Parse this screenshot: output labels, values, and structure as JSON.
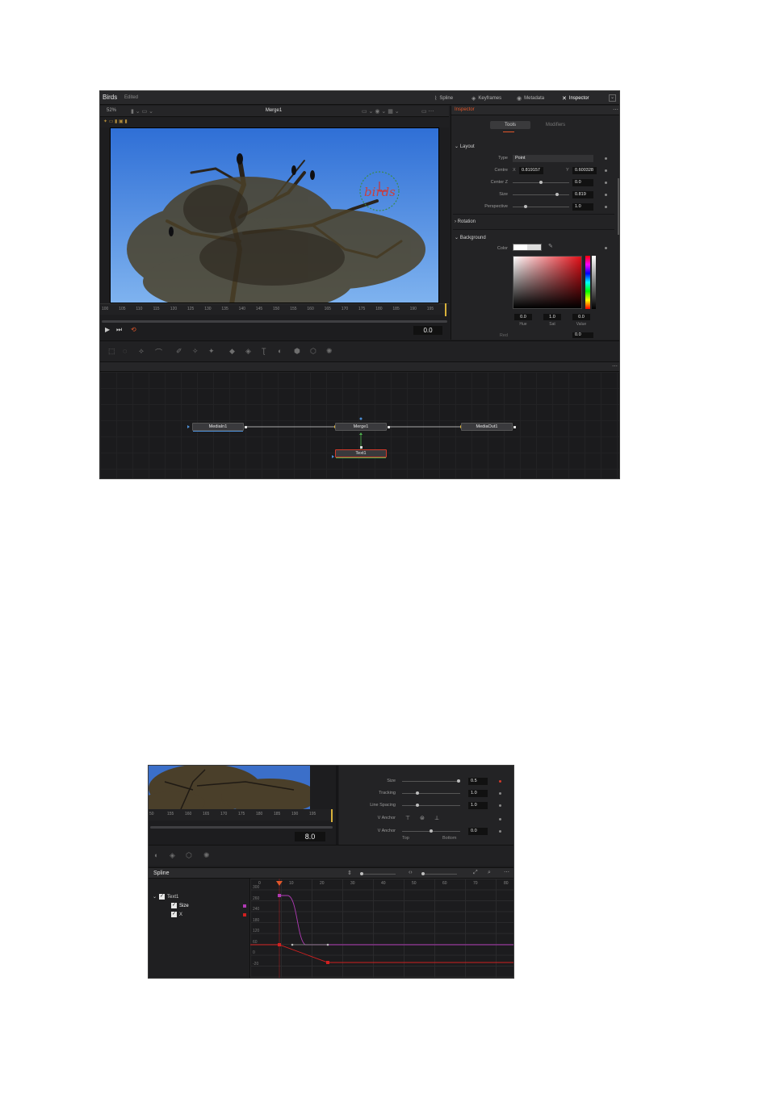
{
  "colors": {
    "accent": "#e2572a",
    "playhead": "#d8b13a",
    "curve_size": "#b03ab5",
    "curve_x": "#d12020",
    "node_blue": "#4d8fd6",
    "node_green": "#4fb54f",
    "node_red": "#d23a2a"
  },
  "shot1": {
    "app_title": "Birds",
    "app_status": "Edited",
    "toolbar": [
      {
        "label": "Spline",
        "icon": "spline-icon",
        "active": false
      },
      {
        "label": "Keyframes",
        "icon": "keyframes-icon",
        "active": false
      },
      {
        "label": "Metadata",
        "icon": "metadata-icon",
        "active": false
      },
      {
        "label": "Inspector",
        "icon": "inspector-icon",
        "active": true
      }
    ],
    "viewer": {
      "zoom": "52%",
      "title": "Merge1",
      "overlay_text": "birds",
      "ruler_labels": [
        "100",
        "105",
        "110",
        "115",
        "120",
        "125",
        "130",
        "135",
        "140",
        "145",
        "150",
        "155",
        "160",
        "165",
        "170",
        "175",
        "180",
        "185",
        "190",
        "195"
      ],
      "time_value": "0.0"
    },
    "inspector": {
      "title": "Inspector",
      "tabs": [
        "Tools",
        "Modifiers"
      ],
      "sections": {
        "layout": "Layout",
        "rotation": "Rotation",
        "background": "Background"
      },
      "type_label": "Type",
      "type_value": "Point",
      "centre_label": "Centre",
      "centre_x_label": "X",
      "centre_x": "0.819157",
      "centre_y_label": "Y",
      "centre_y": "0.600328",
      "centre_z_label": "Center Z",
      "centre_z": "0.0",
      "size_label": "Size",
      "size_value": "0.819",
      "perspective_label": "Perspective",
      "perspective_value": "1.0",
      "color_label": "Color",
      "hue": "0.0",
      "sat": "1.0",
      "value": "0.0",
      "hue_label": "Hue",
      "sat_label": "Sat",
      "value_label": "Value",
      "cut_label": "Red",
      "cut_value": "0.0"
    },
    "nodes": {
      "media_in": "MediaIn1",
      "merge": "Merge1",
      "media_out": "MediaOut1",
      "text": "Text1"
    }
  },
  "shot2": {
    "time_value": "8.0",
    "ruler_labels": [
      "50",
      "155",
      "160",
      "165",
      "170",
      "175",
      "180",
      "185",
      "190",
      "195"
    ],
    "props": [
      {
        "label": "Size",
        "value": "0.5",
        "fraction": 1.0
      },
      {
        "label": "Tracking",
        "value": "1.0",
        "fraction": 0.25
      },
      {
        "label": "Line Spacing",
        "value": "1.0",
        "fraction": 0.25
      }
    ],
    "v_anchor_label": "V Anchor",
    "h_anchor_label": "V Anchor",
    "h_anchor_value": "0.0",
    "h_anchor_fraction": 0.5,
    "anchor_top": "Top",
    "anchor_bottom": "Bottom",
    "spline_title": "Spline",
    "tree": {
      "root": "Text1",
      "items": [
        {
          "label": "Size",
          "color": "#b03ab5"
        },
        {
          "label": "X",
          "color": "#d12020"
        }
      ]
    },
    "graph_x_labels": [
      "0",
      "10",
      "20",
      "30",
      "40",
      "50",
      "60",
      "70",
      "80"
    ],
    "graph_y_labels": [
      "300",
      "260",
      "240",
      "180",
      "120",
      "60",
      "0",
      "-20"
    ]
  }
}
